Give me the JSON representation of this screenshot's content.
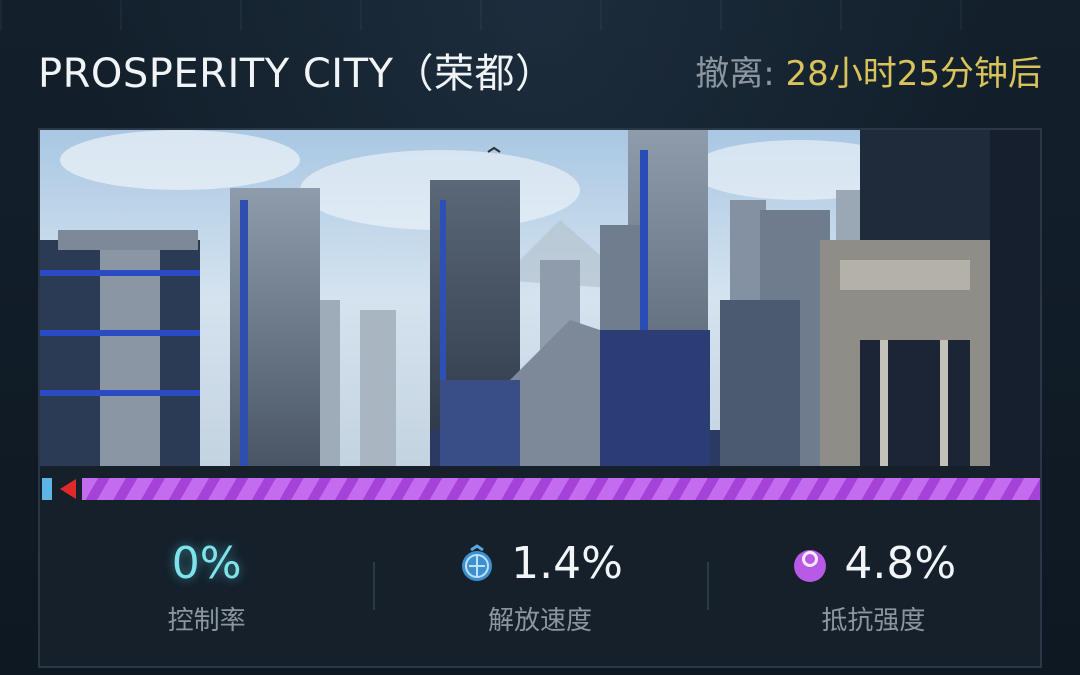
{
  "header": {
    "city_name": "PROSPERITY CITY（荣都）",
    "evacuation_label": "撤离: ",
    "evacuation_value": "28小时25分钟后"
  },
  "progress": {
    "liberation_fraction": 0.01,
    "resistance_fraction": 0.96,
    "colors": {
      "liberation": "#5fb4e6",
      "resistance": "#c46cf0",
      "marker": "#e02a2a"
    }
  },
  "stats": {
    "control": {
      "value": "0%",
      "label": "控制率",
      "color": "#7fe3ec"
    },
    "liberation_speed": {
      "value": "1.4%",
      "label": "解放速度",
      "icon": "globe-liberation-icon"
    },
    "resistance_strength": {
      "value": "4.8%",
      "label": "抵抗强度",
      "icon": "resistance-orb-icon"
    }
  }
}
